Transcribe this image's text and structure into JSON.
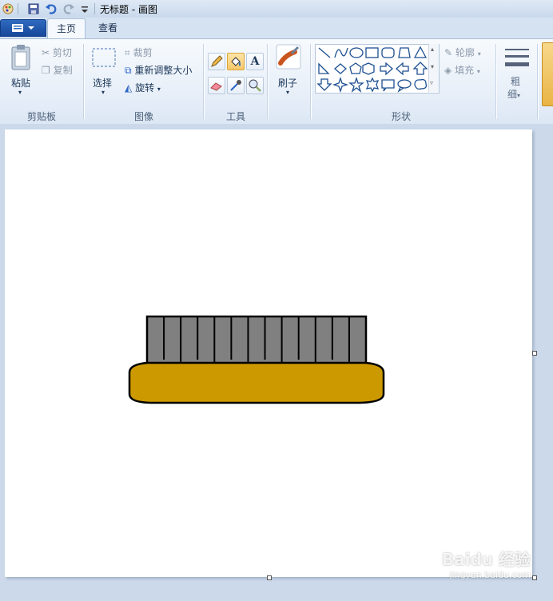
{
  "window": {
    "title": "无标题 - 画图"
  },
  "quick_access": [
    "app-icon",
    "save-icon",
    "undo-icon",
    "redo-icon",
    "customize-dropdown-icon"
  ],
  "tabs": [
    {
      "label": "主页",
      "active": true
    },
    {
      "label": "查看",
      "active": false
    }
  ],
  "ribbon": {
    "clipboard": {
      "label": "剪贴板",
      "paste": "粘贴",
      "cut": "剪切",
      "copy": "复制"
    },
    "image": {
      "label": "图像",
      "select": "选择",
      "crop": "裁剪",
      "resize": "重新调整大小",
      "rotate": "旋转"
    },
    "tools": {
      "label": "工具"
    },
    "brushes": {
      "label": "刷子"
    },
    "shapes": {
      "label": "形状",
      "outline": "轮廓",
      "fill": "填充"
    },
    "size": {
      "label_line1": "粗",
      "label_line2": "细"
    }
  },
  "drawing": {
    "bar_color": "#808080",
    "base_color": "#cc9900",
    "stroke_color": "#000000",
    "vertical_divider_count": 12
  },
  "watermark": {
    "brand": "Baidu 经验",
    "url": "jingyan.baidu.com"
  },
  "colors": {
    "accent": "#f7c86b",
    "ribbon_bg": "#e6eef8",
    "canvas_bg": "#ffffff"
  }
}
